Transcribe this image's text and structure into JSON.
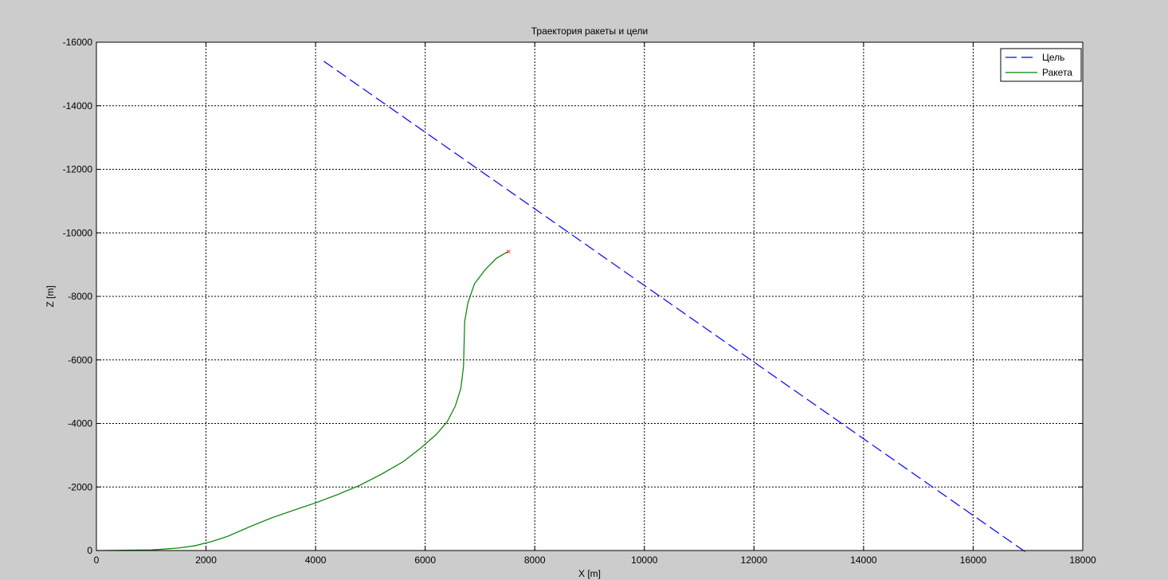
{
  "chart_data": {
    "type": "line",
    "title": "Траектория ракеты и цели",
    "xlabel": "X [m]",
    "ylabel": "Z [m]",
    "xlim": [
      0,
      18000
    ],
    "ylim": [
      0,
      -16000
    ],
    "y_axis_reversed": true,
    "grid": true,
    "legend_position": "top-right",
    "x_ticks": [
      "0",
      "2000",
      "4000",
      "6000",
      "8000",
      "10000",
      "12000",
      "14000",
      "16000",
      "18000"
    ],
    "y_ticks": [
      "0",
      "-2000",
      "-4000",
      "-6000",
      "-8000",
      "-10000",
      "-12000",
      "-14000",
      "-16000"
    ],
    "series": [
      {
        "name": "Цель",
        "color": "#0000ff",
        "style": "dashed",
        "points": [
          [
            4150,
            -15400
          ],
          [
            17000,
            100
          ]
        ]
      },
      {
        "name": "Ракета",
        "color": "#008000",
        "style": "solid",
        "points": [
          [
            0,
            0
          ],
          [
            500,
            -10
          ],
          [
            1000,
            -20
          ],
          [
            1200,
            -40
          ],
          [
            1500,
            -80
          ],
          [
            1800,
            -150
          ],
          [
            2100,
            -280
          ],
          [
            2400,
            -450
          ],
          [
            2800,
            -750
          ],
          [
            3200,
            -1030
          ],
          [
            3600,
            -1270
          ],
          [
            4000,
            -1500
          ],
          [
            4400,
            -1760
          ],
          [
            4800,
            -2050
          ],
          [
            5200,
            -2400
          ],
          [
            5600,
            -2800
          ],
          [
            5900,
            -3200
          ],
          [
            6200,
            -3650
          ],
          [
            6400,
            -4050
          ],
          [
            6550,
            -4550
          ],
          [
            6650,
            -5100
          ],
          [
            6700,
            -5800
          ],
          [
            6710,
            -6500
          ],
          [
            6720,
            -7200
          ],
          [
            6780,
            -7800
          ],
          [
            6900,
            -8400
          ],
          [
            7100,
            -8850
          ],
          [
            7300,
            -9200
          ],
          [
            7500,
            -9400
          ]
        ]
      }
    ],
    "end_marker": {
      "label": "×",
      "x": 7520,
      "y": -9420,
      "color": "#ff0000"
    }
  }
}
